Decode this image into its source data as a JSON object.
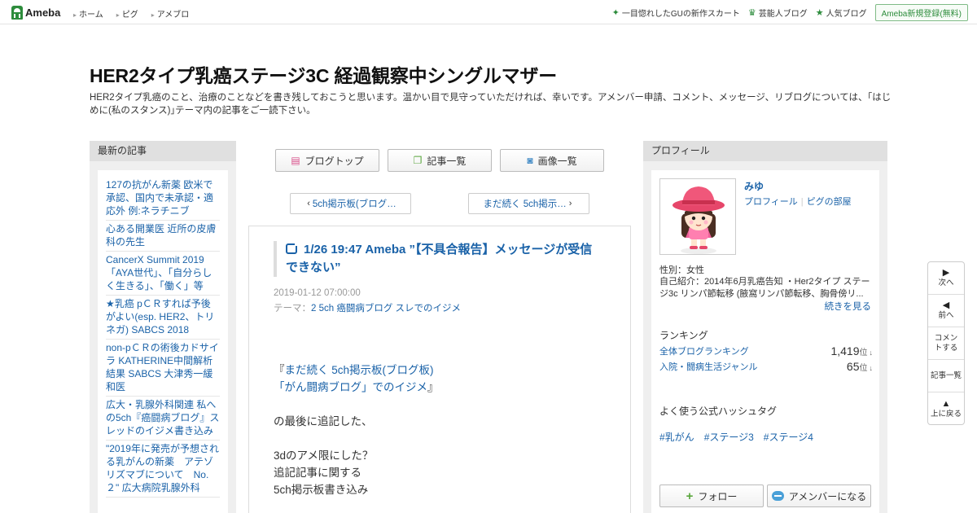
{
  "topbar": {
    "logo_text": "Ameba",
    "nav": [
      "ホーム",
      "ピグ",
      "アメブロ"
    ],
    "right_links": [
      {
        "icon": "sparkle-icon",
        "glyph": "✦",
        "label": "一目惚れしたGUの新作スカート"
      },
      {
        "icon": "crown-icon",
        "glyph": "♛",
        "label": "芸能人ブログ"
      },
      {
        "icon": "star-icon",
        "glyph": "★",
        "label": "人気ブログ"
      }
    ],
    "signup_label": "Ameba新規登録(無料)"
  },
  "blog": {
    "title": "HER2タイプ乳癌ステージ3C 経過観察中シングルマザー",
    "description": "HER2タイプ乳癌のこと、治療のことなどを書き残しておこうと思います。温かい目で見守っていただければ、幸いです。アメンバー申請、コメント、メッセージ、リブログについては、｢はじめに(私のスタンス)｣テーマ内の記事をご一読下さい。"
  },
  "left": {
    "heading": "最新の記事",
    "recent": [
      "127の抗がん新薬 欧米で承認、国内で未承認・適応外 例:ネラチニブ",
      "心ある開業医 近所の皮膚科の先生",
      "CancerX Summit 2019 「AYA世代」、「自分らしく生きる」、「働く」等",
      "★乳癌 pＣＲすれば予後がよい(esp. HER2、トリネガ) SABCS 2018",
      "non-pＣＲの術後カドサイラ KATHERINE中間解析結果 SABCS 大津秀一緩和医",
      "広大・乳腺外科関連 私への5ch『癌闘病ブログ』スレッドのイジメ書き込み",
      "\"2019年に発売が予想される乳がんの新薬　アテゾリズマブについて　No.２\" 広大病院乳腺外科"
    ]
  },
  "center": {
    "buttons": [
      {
        "icon": "blog-top-icon",
        "glyph": "▤",
        "label": "ブログトップ"
      },
      {
        "icon": "article-list-icon",
        "glyph": "❐",
        "label": "記事一覧"
      },
      {
        "icon": "camera-icon",
        "glyph": "◙",
        "label": "画像一覧"
      }
    ],
    "prev_label": "5ch掲示板(ブログ…",
    "next_label": "まだ続く 5ch掲示…",
    "entry": {
      "title": "1/26 19:47 Ameba ”【不具合報告】メッセージが受信できない”",
      "date": "2019-01-12 07:00:00",
      "theme_prefix": "テーマ：",
      "theme": "2 5ch 癌闘病ブログ スレでのイジメ",
      "link_line1": "まだ続く 5ch掲示板(ブログ板)",
      "link_line2": "「がん闘病ブログ」でのイジメ",
      "quote_open": "『",
      "quote_close": "』",
      "line_after": "の最後に追記した、",
      "line_3d": "3dのアメ限にした？",
      "line_related": "追記記事に関する",
      "line_5ch": "5ch掲示板書き込み"
    }
  },
  "profile": {
    "heading": "プロフィール",
    "name": "みゆ",
    "link_profile": "プロフィール",
    "link_separator": "|",
    "link_pig": "ピグの部屋",
    "gender": "性別：女性",
    "intro": "自己紹介：2014年6月乳癌告知 ・Her2タイプ ステージ3c リンパ節転移 (腋窩リンパ節転移、胸骨傍リ...",
    "more": "続きを見る",
    "ranking_heading": "ランキング",
    "rankings": [
      {
        "label": "全体ブログランキング",
        "value": "1,419",
        "unit": "位",
        "arrow": "↓"
      },
      {
        "label": "入院・闘病生活ジャンル",
        "value": "65",
        "unit": "位",
        "arrow": "↓"
      }
    ],
    "hashtag_heading": "よく使う公式ハッシュタグ",
    "hashtags": [
      "#乳がん",
      "#ステージ3",
      "#ステージ4"
    ],
    "follow_label": "フォロー",
    "member_label": "アメンバーになる"
  },
  "sidenav": {
    "next": "次へ",
    "prev": "前へ",
    "comment": "コメントする",
    "list": "記事一覧",
    "top": "上に戻る"
  },
  "colors": {
    "link": "#1a62a8",
    "brand_green": "#2d8c3c",
    "panel_bg": "#efefef"
  }
}
